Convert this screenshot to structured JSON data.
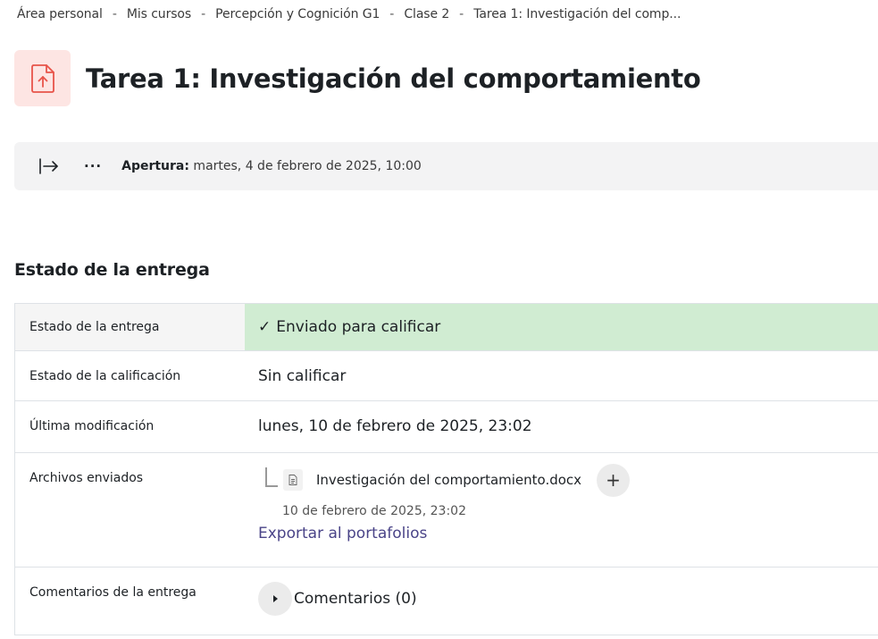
{
  "breadcrumb": [
    {
      "label": "Área personal"
    },
    {
      "label": "Mis cursos"
    },
    {
      "label": "Percepción y Cognición G1"
    },
    {
      "label": "Clase 2"
    },
    {
      "label": "Tarea 1: Investigación del comp..."
    }
  ],
  "breadcrumb_separator": "-",
  "header": {
    "title": "Tarea 1: Investigación del comportamiento",
    "icon": "file-upload-icon"
  },
  "dates": {
    "collapse_icon": "arrow-right-to-bar-icon",
    "more_label": "···",
    "opening_label": "Apertura:",
    "opening_value": " martes, 4 de febrero de 2025, 10:00"
  },
  "submission": {
    "section_title": "Estado de la entrega",
    "rows": [
      {
        "label": "Estado de la entrega",
        "value": "Enviado para calificar",
        "check": "✓"
      },
      {
        "label": "Estado de la calificación",
        "value": "Sin calificar"
      },
      {
        "label": "Última modificación",
        "value": "lunes, 10 de febrero de 2025, 23:02"
      },
      {
        "label": "Archivos enviados"
      },
      {
        "label": "Comentarios de la entrega"
      }
    ],
    "file": {
      "name": "Investigación del comportamiento.docx",
      "date": "10 de febrero de 2025, 23:02",
      "plus_label": "+",
      "export_label": "Exportar al portafolios"
    },
    "comments_label": "Comentarios (0)"
  },
  "colors": {
    "success_bg": "#d0ecd2",
    "icon_bg": "#fde5e3",
    "icon_accent": "#e8544a",
    "link": "#4a4488"
  }
}
